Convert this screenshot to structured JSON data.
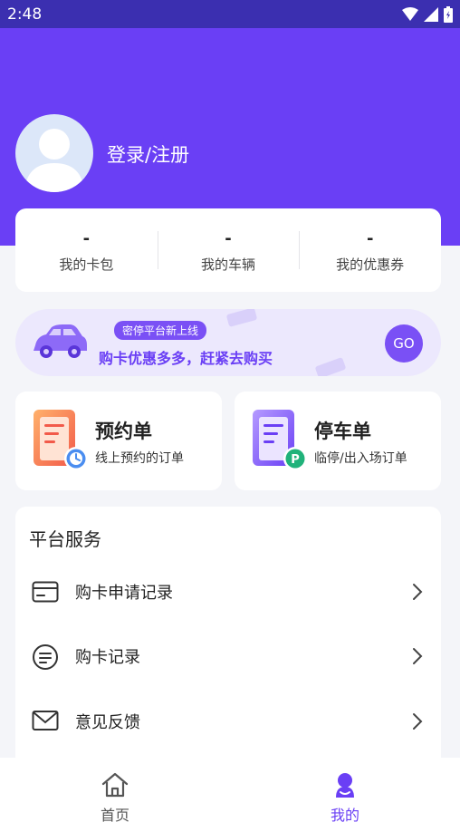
{
  "status_bar": {
    "time": "2:48",
    "icons": [
      "wifi-icon",
      "signal-icon",
      "battery-icon"
    ]
  },
  "profile": {
    "login_label": "登录/注册",
    "avatar": "default-user-avatar"
  },
  "stats": [
    {
      "value": "-",
      "label": "我的卡包"
    },
    {
      "value": "-",
      "label": "我的车辆"
    },
    {
      "value": "-",
      "label": "我的优惠券"
    }
  ],
  "promo": {
    "tag": "密停平台新上线",
    "text": "购卡优惠多多，赶紧去购买",
    "go_label": "GO"
  },
  "orders": [
    {
      "title": "预约单",
      "subtitle": "线上预约的订单"
    },
    {
      "title": "停车单",
      "subtitle": "临停/出入场订单"
    }
  ],
  "services": {
    "title": "平台服务",
    "items": [
      {
        "label": "购卡申请记录",
        "icon": "card-icon"
      },
      {
        "label": "购卡记录",
        "icon": "list-circle-icon"
      },
      {
        "label": "意见反馈",
        "icon": "mail-icon"
      }
    ]
  },
  "tabbar": {
    "items": [
      {
        "label": "首页",
        "icon": "home-icon",
        "active": false
      },
      {
        "label": "我的",
        "icon": "profile-icon",
        "active": true
      }
    ]
  },
  "colors": {
    "primary": "#6a3ff5",
    "accent": "#7a50f5",
    "status_bar": "#3b2fb0",
    "promo_bg": "#ece8fd"
  }
}
